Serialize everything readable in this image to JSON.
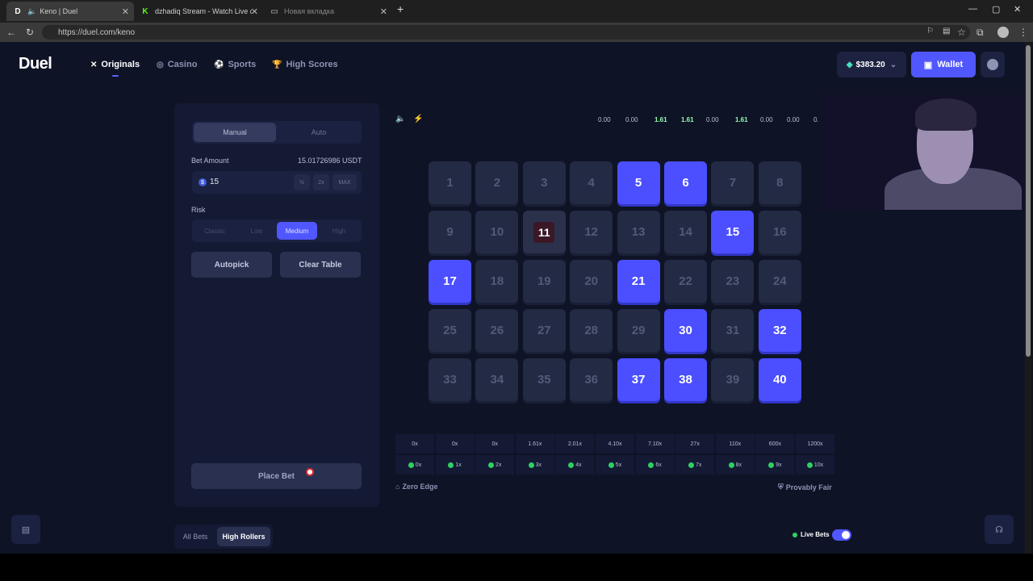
{
  "browser": {
    "tabs": [
      {
        "label": "Keno | Duel",
        "favicon": "D"
      },
      {
        "label": "dzhadiq Stream - Watch Live on K",
        "favicon": "K"
      },
      {
        "label": "Новая вкладка",
        "favicon": ""
      }
    ],
    "new_tab": "+",
    "url": "https://duel.com/keno"
  },
  "header": {
    "logo": "Duel",
    "nav": [
      {
        "label": "Originals",
        "icon": "originals-icon"
      },
      {
        "label": "Casino",
        "icon": "casino-icon"
      },
      {
        "label": "Sports",
        "icon": "sports-icon"
      },
      {
        "label": "High Scores",
        "icon": "trophy-icon"
      }
    ],
    "balance": "$383.20",
    "wallet_label": "Wallet"
  },
  "bet_panel": {
    "modes": [
      "Manual",
      "Auto"
    ],
    "bet_amount_label": "Bet Amount",
    "bet_amount_usdt": "15.01726986 USDT",
    "bet_value": "15",
    "coin_symbol": "$",
    "half_label": "½",
    "double_label": "2x",
    "max_label": "MAX",
    "risk_label": "Risk",
    "risk_options": [
      "Classic",
      "Low",
      "Medium",
      "High"
    ],
    "risk_selected": "Medium",
    "autopick_label": "Autopick",
    "clear_label": "Clear Table",
    "place_bet_label": "Place Bet"
  },
  "history": [
    "0.00",
    "0.00",
    "1.61",
    "1.61",
    "0.00",
    "1.61",
    "0.00",
    "0.00",
    "0."
  ],
  "history_green": [
    false,
    false,
    true,
    true,
    false,
    true,
    false,
    false,
    false
  ],
  "tiles": {
    "numbers": [
      1,
      2,
      3,
      4,
      5,
      6,
      7,
      8,
      9,
      10,
      11,
      12,
      13,
      14,
      15,
      16,
      17,
      18,
      19,
      20,
      21,
      22,
      23,
      24,
      25,
      26,
      27,
      28,
      29,
      30,
      31,
      32,
      33,
      34,
      35,
      36,
      37,
      38,
      39,
      40
    ],
    "selected": [
      5,
      6,
      15,
      17,
      21,
      30,
      32,
      37,
      38,
      40
    ],
    "hit": [
      11
    ]
  },
  "payouts": {
    "multipliers": [
      "0x",
      "0x",
      "0x",
      "1.61x",
      "2.01x",
      "4.10x",
      "7.10x",
      "27x",
      "110x",
      "600x",
      "1200x"
    ],
    "hits": [
      "0x",
      "1x",
      "2x",
      "3x",
      "4x",
      "5x",
      "6x",
      "7x",
      "8x",
      "9x",
      "10x"
    ]
  },
  "footer": {
    "zero_edge": "Zero Edge",
    "provably_fair": "Provably Fair"
  },
  "bottom": {
    "tabs": [
      "All Bets",
      "High Rollers"
    ],
    "selected": "High Rollers",
    "live_bets": "Live Bets"
  },
  "colors": {
    "accent": "#5157ff",
    "tile_selected": "#4b4fff",
    "background": "#0f1326",
    "panel": "#141a33"
  }
}
